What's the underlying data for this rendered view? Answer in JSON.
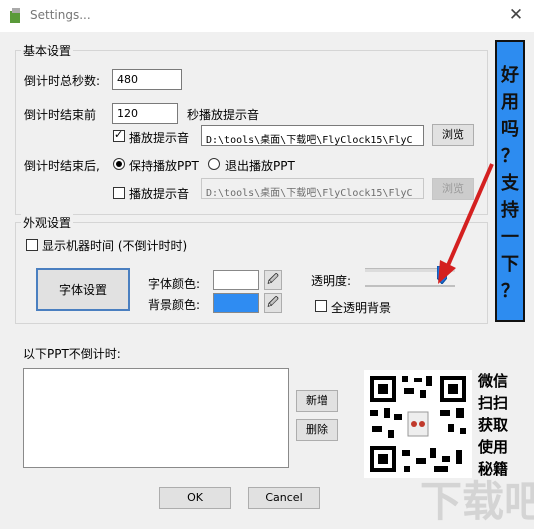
{
  "window": {
    "title": "Settings..."
  },
  "basic": {
    "group_label": "基本设置",
    "total_seconds_label": "倒计时总秒数:",
    "total_seconds_value": "480",
    "before_end_label": "倒计时结束前",
    "before_end_value": "120",
    "before_end_suffix": "秒播放提示音",
    "play_sound_label": "播放提示音",
    "sound_path_1": "D:\\tools\\桌面\\下载吧\\FlyClock15\\FlyC",
    "browse_label": "浏览",
    "after_end_label": "倒计时结束后,",
    "keep_ppt_label": "保持播放PPT",
    "exit_ppt_label": "退出播放PPT",
    "play_sound2_label": "播放提示音",
    "sound_path_2": "D:\\tools\\桌面\\下载吧\\FlyClock15\\FlyC",
    "browse2_label": "浏览"
  },
  "appearance": {
    "group_label": "外观设置",
    "show_machine_time_label": "显示机器时间 (不倒计时时)",
    "font_button": "字体设置",
    "font_color_label": "字体颜色:",
    "bg_color_label": "背景颜色:",
    "font_color": "#ffffff",
    "bg_color": "#2f8cf2",
    "transparency_label": "透明度:",
    "transparency_level": 0.9,
    "full_transparent_label": "全透明背景"
  },
  "exclusions": {
    "label": "以下PPT不倒计时:",
    "add_button": "新增",
    "delete_button": "删除"
  },
  "footer": {
    "ok": "OK",
    "cancel": "Cancel"
  },
  "overlay": {
    "ad_vertical_text": "好用吗？支持一下？",
    "qr_caption": [
      "微信",
      "扫扫",
      "获取",
      "使用",
      "秘籍"
    ],
    "watermark": "下载吧"
  }
}
